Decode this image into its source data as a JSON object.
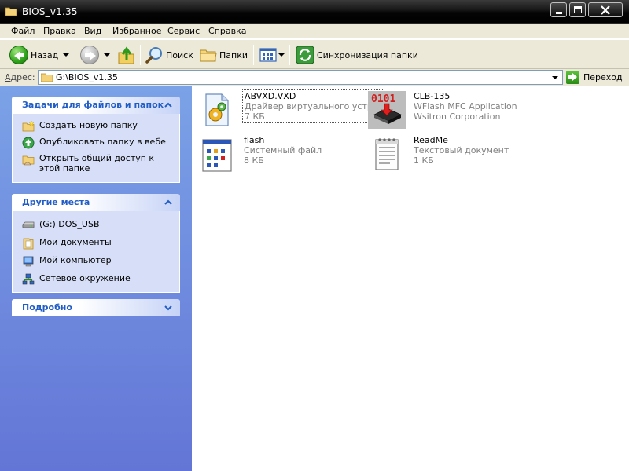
{
  "window": {
    "title": "BIOS_v1.35"
  },
  "menu": {
    "items": [
      "Файл",
      "Правка",
      "Вид",
      "Избранное",
      "Сервис",
      "Справка"
    ]
  },
  "toolbar": {
    "back_label": "Назад",
    "search_label": "Поиск",
    "folders_label": "Папки",
    "sync_label": "Синхронизация папки"
  },
  "address": {
    "label": "Адрес:",
    "value": "G:\\BIOS_v1.35",
    "go_label": "Переход"
  },
  "tasks_panel": {
    "title": "Задачи для файлов и папок",
    "items": [
      {
        "label": "Создать новую папку",
        "icon": "new-folder-icon"
      },
      {
        "label": "Опубликовать папку в вебе",
        "icon": "publish-web-icon"
      },
      {
        "label": "Открыть общий доступ к этой папке",
        "icon": "share-folder-icon"
      }
    ]
  },
  "places_panel": {
    "title": "Другие места",
    "items": [
      {
        "label": "(G:) DOS_USB",
        "icon": "drive-icon"
      },
      {
        "label": "Мои документы",
        "icon": "my-documents-icon"
      },
      {
        "label": "Мой компьютер",
        "icon": "my-computer-icon"
      },
      {
        "label": "Сетевое окружение",
        "icon": "network-icon"
      }
    ]
  },
  "details_panel": {
    "title": "Подробно"
  },
  "files": [
    {
      "name": "ABVXD.VXD",
      "line2": "Драйвер виртуального устр...",
      "line3": "7 КБ",
      "icon": "driver-file-icon"
    },
    {
      "name": "CLB-135",
      "line2": "WFlash MFC Application",
      "line3": "Wsitron Corporation",
      "icon": "wflash-app-icon"
    },
    {
      "name": "flash",
      "line2": "Системный файл",
      "line3": "8 КБ",
      "icon": "system-file-icon"
    },
    {
      "name": "ReadMe",
      "line2": "Текстовый документ",
      "line3": "1 КБ",
      "icon": "text-document-icon"
    }
  ],
  "colors": {
    "title_bar": "#000000",
    "task_pane_top": "#7ba2e7",
    "task_pane_bottom": "#6375d6",
    "panel_title": "#215dc6",
    "chrome": "#ece9d8"
  }
}
